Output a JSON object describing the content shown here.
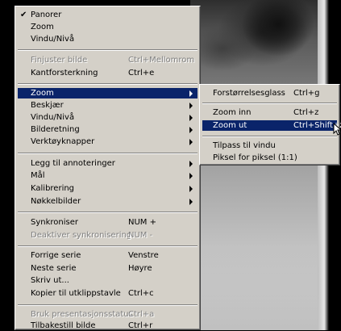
{
  "main_menu": {
    "items": [
      {
        "label": "Panorer",
        "shortcut": "",
        "checked": true,
        "disabled": false,
        "submenu": false
      },
      {
        "label": "Zoom",
        "shortcut": "",
        "checked": false,
        "disabled": false,
        "submenu": false
      },
      {
        "label": "Vindu/Nivå",
        "shortcut": "",
        "checked": false,
        "disabled": false,
        "submenu": false
      },
      {
        "label": "Finjuster bilde",
        "shortcut": "Ctrl+Mellomrom",
        "checked": false,
        "disabled": true,
        "submenu": false
      },
      {
        "label": "Kantforsterkning",
        "shortcut": "Ctrl+e",
        "checked": false,
        "disabled": false,
        "submenu": false
      },
      {
        "label": "Zoom",
        "shortcut": "",
        "checked": false,
        "disabled": false,
        "submenu": true,
        "selected": true
      },
      {
        "label": "Beskjær",
        "shortcut": "",
        "checked": false,
        "disabled": false,
        "submenu": true
      },
      {
        "label": "Vindu/Nivå",
        "shortcut": "",
        "checked": false,
        "disabled": false,
        "submenu": true
      },
      {
        "label": "Bilderetning",
        "shortcut": "",
        "checked": false,
        "disabled": false,
        "submenu": true
      },
      {
        "label": "Verktøyknapper",
        "shortcut": "",
        "checked": false,
        "disabled": false,
        "submenu": true
      },
      {
        "label": "Legg til annoteringer",
        "shortcut": "",
        "checked": false,
        "disabled": false,
        "submenu": true
      },
      {
        "label": "Mål",
        "shortcut": "",
        "checked": false,
        "disabled": false,
        "submenu": true
      },
      {
        "label": "Kalibrering",
        "shortcut": "",
        "checked": false,
        "disabled": false,
        "submenu": true
      },
      {
        "label": "Nøkkelbilder",
        "shortcut": "",
        "checked": false,
        "disabled": false,
        "submenu": true
      },
      {
        "label": "Synkroniser",
        "shortcut": "NUM +",
        "checked": false,
        "disabled": false,
        "submenu": false
      },
      {
        "label": "Deaktiver synkronisering",
        "shortcut": "NUM -",
        "checked": false,
        "disabled": true,
        "submenu": false
      },
      {
        "label": "Forrige serie",
        "shortcut": "Venstre",
        "checked": false,
        "disabled": false,
        "submenu": false
      },
      {
        "label": "Neste serie",
        "shortcut": "Høyre",
        "checked": false,
        "disabled": false,
        "submenu": false
      },
      {
        "label": "Skriv ut...",
        "shortcut": "",
        "checked": false,
        "disabled": false,
        "submenu": false
      },
      {
        "label": "Kopier til utklippstavle",
        "shortcut": "Ctrl+c",
        "checked": false,
        "disabled": false,
        "submenu": false
      },
      {
        "label": "Bruk presentasjonsstatus",
        "shortcut": "Ctrl+a",
        "checked": false,
        "disabled": true,
        "submenu": false
      },
      {
        "label": "Tilbakestill bilde",
        "shortcut": "Ctrl+r",
        "checked": false,
        "disabled": false,
        "submenu": false
      }
    ]
  },
  "zoom_submenu": {
    "items": [
      {
        "label": "Forstørrelsesglass",
        "shortcut": "Ctrl+g"
      },
      {
        "label": "Zoom inn",
        "shortcut": "Ctrl+z"
      },
      {
        "label": "Zoom ut",
        "shortcut": "Ctrl+Shift+z",
        "selected": true
      },
      {
        "label": "Tilpass til vindu",
        "shortcut": ""
      },
      {
        "label": "Piksel for piksel (1:1)",
        "shortcut": ""
      }
    ]
  },
  "colors": {
    "menu_bg": "#d4d0c8",
    "highlight": "#0a246a",
    "disabled": "#808080"
  }
}
